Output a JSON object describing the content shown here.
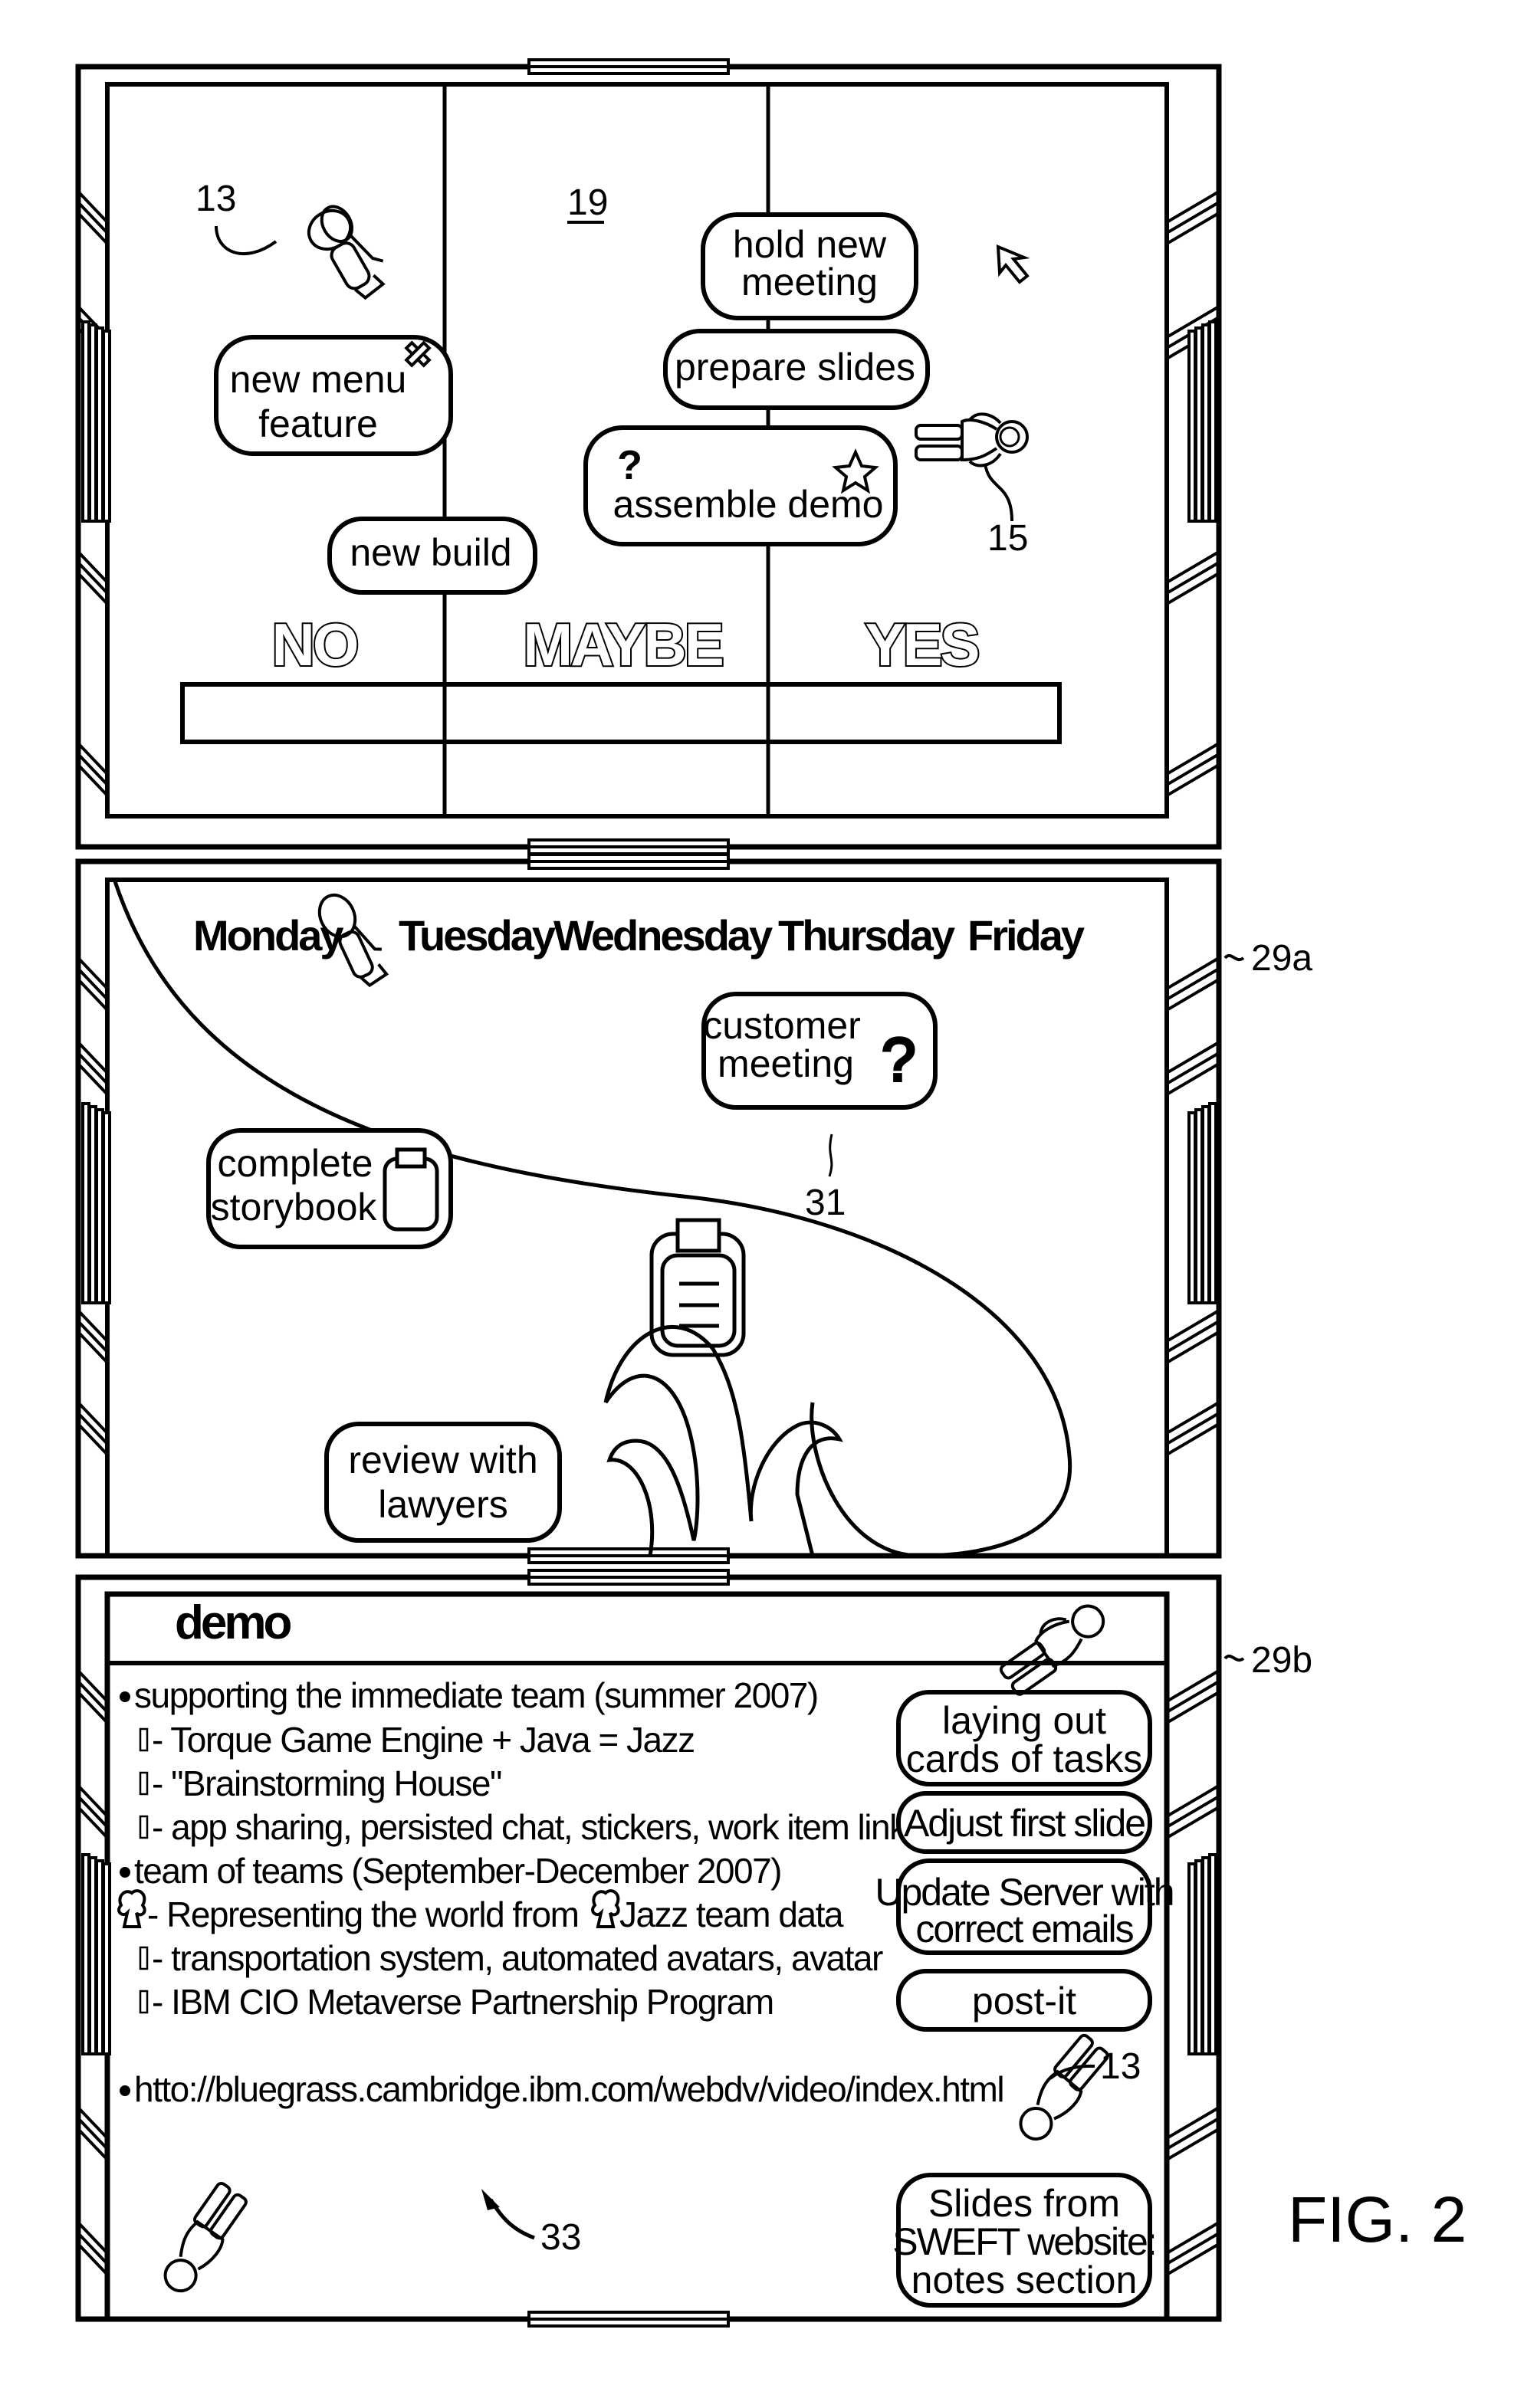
{
  "figure_label": "FIG. 2",
  "reference_numerals": {
    "avatar_13_top": "13",
    "room_19": "19",
    "avatar_15": "15",
    "panel_29a": "29a",
    "panel_29b": "29b",
    "path_31": "31",
    "slide_33": "33",
    "avatar_13_bottom": "13"
  },
  "panel_top": {
    "columns": [
      "NO",
      "MAYBE",
      "YES"
    ],
    "cards": [
      {
        "lines": [
          "new menu",
          "feature"
        ],
        "icon": "close-x-icon"
      },
      {
        "lines": [
          "new build"
        ]
      },
      {
        "lines": [
          "hold new",
          "meeting"
        ]
      },
      {
        "lines": [
          "prepare slides"
        ]
      },
      {
        "lines": [
          "assemble demo"
        ],
        "icons": [
          "question-mark-icon",
          "star-icon"
        ]
      }
    ],
    "pointer": "cursor-arrow-icon"
  },
  "panel_middle": {
    "days": [
      "Monday",
      "Tuesday",
      "Wednesday",
      "Thursday",
      "Friday"
    ],
    "cards": [
      {
        "lines": [
          "customer",
          "meeting"
        ],
        "icon": "question-mark-icon"
      },
      {
        "lines": [
          "complete",
          "storybook"
        ],
        "icon": "clipboard-icon"
      },
      {
        "lines": [
          "review with",
          "lawyers"
        ]
      }
    ],
    "objects": [
      "clipboard-icon",
      "wave-icon"
    ]
  },
  "panel_bottom": {
    "title": "demo",
    "bullets": [
      {
        "type": "bullet",
        "text": "supporting the immediate team (summer 2007)"
      },
      {
        "type": "sub",
        "text": " - Torque Game Engine + Java = Jazz"
      },
      {
        "type": "sub",
        "text": " - \"Brainstorming House\""
      },
      {
        "type": "sub",
        "text": " -  app sharing, persisted chat, stickers, work item link"
      },
      {
        "type": "bullet",
        "text": "team of teams (September-December 2007)"
      },
      {
        "type": "sub-icon",
        "text": "- Representing the world from",
        "text2": "Jazz team data"
      },
      {
        "type": "sub",
        "text": " - transportation system, automated avatars, avatar"
      },
      {
        "type": "sub",
        "text": " - IBM CIO Metaverse Partnership Program"
      },
      {
        "type": "bullet",
        "text": "htto://bluegrass.cambridge.ibm.com/webdv/video/index.html"
      }
    ],
    "cards": [
      {
        "lines": [
          "laying out",
          "cards of tasks"
        ]
      },
      {
        "lines": [
          "Adjust first slide"
        ]
      },
      {
        "lines": [
          "Update Server with",
          "correct emails"
        ]
      },
      {
        "lines": [
          "post-it"
        ]
      },
      {
        "lines": [
          "Slides from",
          "SWEFT website:",
          "notes section"
        ]
      }
    ]
  }
}
